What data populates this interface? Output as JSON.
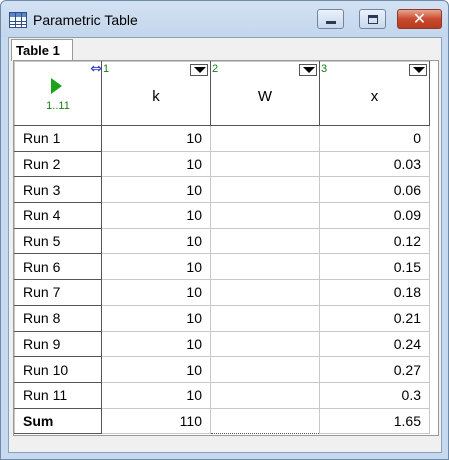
{
  "window": {
    "title": "Parametric Table",
    "close_glyph": "✕"
  },
  "tabs": [
    {
      "label": "Table 1"
    }
  ],
  "corner": {
    "run_range": "1..11"
  },
  "columns": [
    {
      "number": "1",
      "name": "k"
    },
    {
      "number": "2",
      "name": "W"
    },
    {
      "number": "3",
      "name": "x"
    }
  ],
  "rows": [
    {
      "label": "Run 1",
      "k": "10",
      "W": "",
      "x": "0"
    },
    {
      "label": "Run 2",
      "k": "10",
      "W": "",
      "x": "0.03"
    },
    {
      "label": "Run 3",
      "k": "10",
      "W": "",
      "x": "0.06"
    },
    {
      "label": "Run 4",
      "k": "10",
      "W": "",
      "x": "0.09"
    },
    {
      "label": "Run 5",
      "k": "10",
      "W": "",
      "x": "0.12"
    },
    {
      "label": "Run 6",
      "k": "10",
      "W": "",
      "x": "0.15"
    },
    {
      "label": "Run 7",
      "k": "10",
      "W": "",
      "x": "0.18"
    },
    {
      "label": "Run 8",
      "k": "10",
      "W": "",
      "x": "0.21"
    },
    {
      "label": "Run 9",
      "k": "10",
      "W": "",
      "x": "0.24"
    },
    {
      "label": "Run 10",
      "k": "10",
      "W": "",
      "x": "0.27"
    },
    {
      "label": "Run 11",
      "k": "10",
      "W": "",
      "x": "0.3"
    }
  ],
  "sum_row": {
    "label": "Sum",
    "k": "110",
    "W": "",
    "x": "1.65"
  },
  "icons": {
    "app": "table-icon",
    "run": "play-icon",
    "resize": "column-resize-icon",
    "sort": "dropdown-triangle-icon"
  }
}
